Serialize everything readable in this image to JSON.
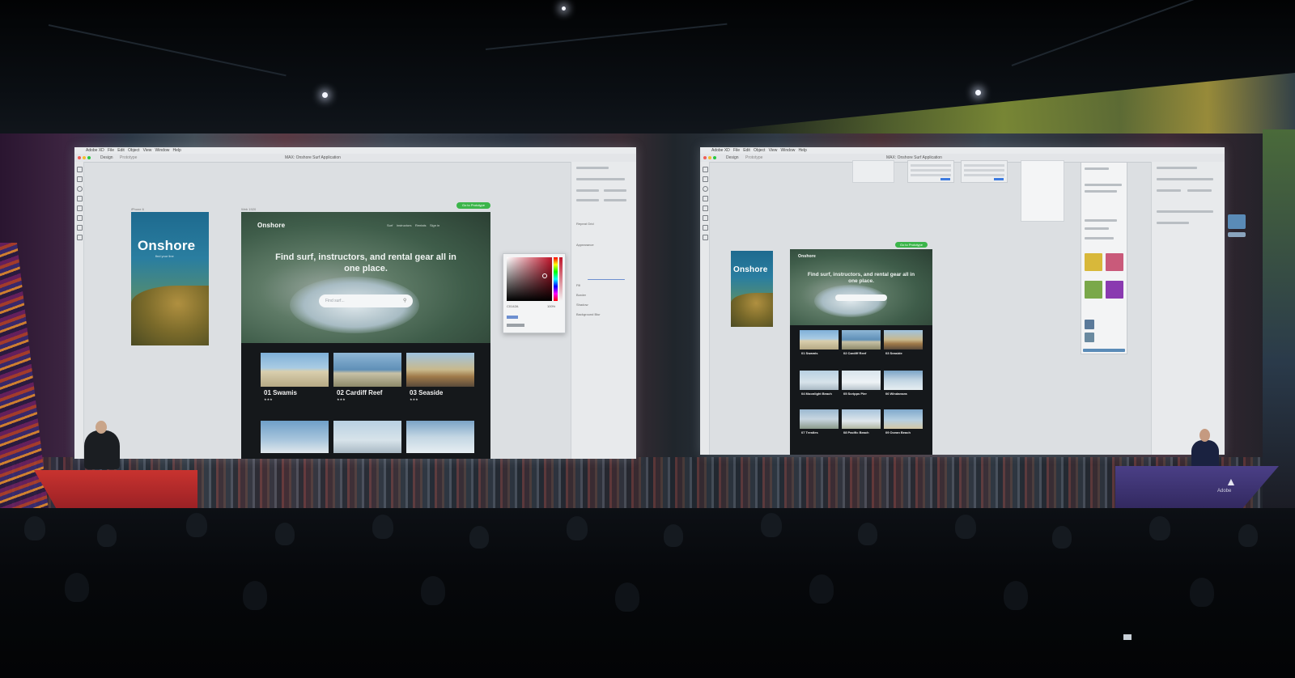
{
  "left_app": {
    "menu_items": [
      "Adobe XD",
      "File",
      "Edit",
      "Object",
      "View",
      "Window",
      "Help"
    ],
    "window_title": "MAX: Onshore Surf Application",
    "mode_tabs": [
      "Design",
      "Prototype"
    ],
    "artboards": {
      "mobile": {
        "label": "iPhone 6",
        "brand": "Onshore",
        "tagline": "find your line"
      },
      "web": {
        "label": "Web 1920",
        "brand": "Onshore",
        "headline": "Find surf, instructors, and rental gear all in one place.",
        "search_placeholder": "Find surf...",
        "nav_links": [
          "Surf",
          "Instructors",
          "Rentals",
          "Sign in"
        ],
        "badge": "Go to Prototype",
        "cards": [
          {
            "title": "01 Swamis",
            "stars": "★★★"
          },
          {
            "title": "02 Cardiff Reef",
            "stars": "★★★"
          },
          {
            "title": "03 Seaside",
            "stars": "★★★"
          }
        ]
      }
    },
    "color_picker": {
      "selected_color": "#c0142a",
      "hex_value": "C0142A",
      "alpha": "100%"
    },
    "inspector_labels": [
      "Repeat Grid",
      "Appearance",
      "Fill",
      "Border",
      "Shadow",
      "Background Blur"
    ]
  },
  "right_app": {
    "menu_items": [
      "Adobe XD",
      "File",
      "Edit",
      "Object",
      "View",
      "Window",
      "Help"
    ],
    "window_title": "MAX: Onshore Surf Application",
    "mode_tabs": [
      "Design",
      "Prototype"
    ],
    "artboards": {
      "mobile": {
        "brand": "Onshore"
      },
      "web": {
        "brand": "Onshore",
        "headline": "Find surf, instructors, and rental gear all in one place.",
        "badge": "Go to Prototype",
        "cards": [
          {
            "title": "01 Swamis"
          },
          {
            "title": "02 Cardiff Reef"
          },
          {
            "title": "03 Seaside"
          },
          {
            "title": "04 Moonlight Beach"
          },
          {
            "title": "05 Scripps Pier"
          },
          {
            "title": "06 Windansea"
          },
          {
            "title": "07 Trestles"
          },
          {
            "title": "08 Pacific Beach"
          },
          {
            "title": "09 Ocean Beach"
          }
        ]
      }
    }
  },
  "stage": {
    "logo": "Adobe",
    "colors": {
      "podium_left": "#c8332f",
      "podium_right": "#4a3f86",
      "accent_green": "#3bb54a"
    }
  }
}
